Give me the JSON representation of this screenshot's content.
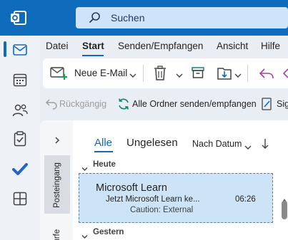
{
  "search": {
    "placeholder": "Suchen"
  },
  "rail": {
    "items": [
      {
        "name": "mail-icon"
      },
      {
        "name": "calendar-icon"
      },
      {
        "name": "people-icon"
      },
      {
        "name": "tasks-icon"
      },
      {
        "name": "todo-icon"
      },
      {
        "name": "apps-icon"
      }
    ]
  },
  "menu": {
    "items": [
      "Datei",
      "Start",
      "Senden/Empfangen",
      "Ansicht",
      "Hilfe"
    ],
    "active": "Start"
  },
  "ribbon": {
    "new_mail_label": "Neue E-Mail"
  },
  "toolbar2": {
    "undo_label": "Rückgängig",
    "send_receive_label": "Alle Ordner senden/empfangen",
    "sig_label": "Sig"
  },
  "folders": {
    "inbox": "Posteingang",
    "drafts": "würfe"
  },
  "list": {
    "tabs": [
      "Alle",
      "Ungelesen"
    ],
    "sort_label": "Nach Datum",
    "groups": {
      "today": "Heute",
      "yesterday": "Gestern"
    },
    "message": {
      "sender": "Microsoft Learn",
      "subject": "Jetzt Microsoft Learn ke...",
      "time": "06:26",
      "preview": "Caution: External"
    }
  },
  "colors": {
    "accent": "#0f6cbd",
    "selected_row": "#cde4f7"
  }
}
